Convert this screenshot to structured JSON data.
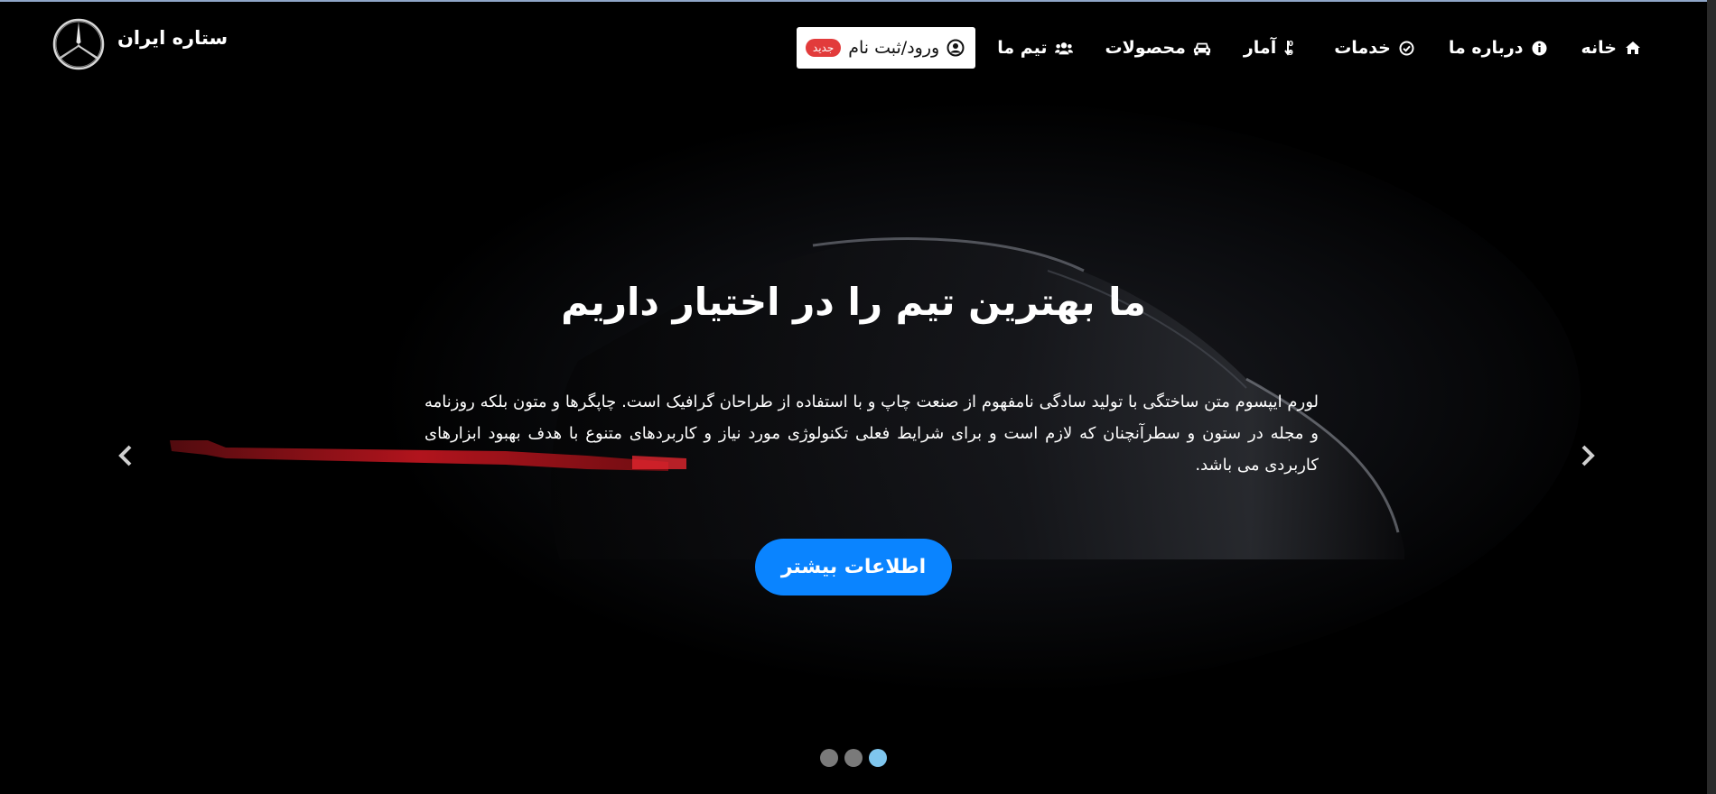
{
  "brand": {
    "name": "ستاره ایران",
    "logo_icon": "mercedes-star-icon"
  },
  "nav": {
    "items": [
      {
        "label": "خانه",
        "icon": "home-icon"
      },
      {
        "label": "درباره ما",
        "icon": "info-circle-icon"
      },
      {
        "label": "خدمات",
        "icon": "check-circle-icon"
      },
      {
        "label": "آمار",
        "icon": "sort-numeric-icon"
      },
      {
        "label": "محصولات",
        "icon": "car-icon"
      },
      {
        "label": "تیم ما",
        "icon": "users-icon"
      }
    ],
    "login": {
      "label": "ورود/ثبت نام",
      "icon": "user-circle-icon",
      "badge": "جدید"
    }
  },
  "hero": {
    "title": "ما بهترین تیم را در اختیار داریم",
    "text": "لورم ایپسوم متن ساختگی با تولید سادگی نامفهوم از صنعت چاپ و با استفاده از طراحان گرافیک است. چاپگرها و متون بلکه روزنامه و مجله در ستون و سطرآنچنان که لازم است و برای شرایط فعلی تکنولوژی مورد نیاز و کاربردهای متنوع با هدف بهبود ابزارهای کاربردی می باشد.",
    "cta_label": "اطلاعات بیشتر"
  },
  "carousel": {
    "slide_count": 3,
    "active_index": 2,
    "prev_icon": "chevron-left-icon",
    "next_icon": "chevron-right-icon"
  },
  "colors": {
    "background": "#000000",
    "accent": "#0a84ff",
    "badge": "#e23b3b",
    "indicator_active": "#7fc6ee",
    "indicator_inactive": "#7a7a7a"
  }
}
